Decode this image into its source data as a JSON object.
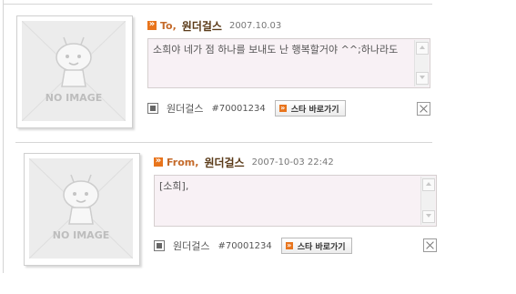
{
  "entries": [
    {
      "photo_label": "NO IMAGE",
      "direction": "To,",
      "nickname": "원더걸스",
      "date": "2007.10.03",
      "message": "소희야 네가 점 하나를 보내도 난 행복할거야 ^^;하나라도",
      "footer_nick": "원더걸스",
      "code": "#70001234",
      "star_button": "스타 바로가기"
    },
    {
      "photo_label": "NO IMAGE",
      "direction": "From,",
      "nickname": "원더걸스",
      "date": "2007-10-03 22:42",
      "message": "[소희],",
      "footer_nick": "원더걸스",
      "code": "#70001234",
      "star_button": "스타 바로가기"
    }
  ],
  "colors": {
    "accent": "#e8741c",
    "message_bg": "#f8f1f5",
    "nick": "#5a3a18"
  }
}
